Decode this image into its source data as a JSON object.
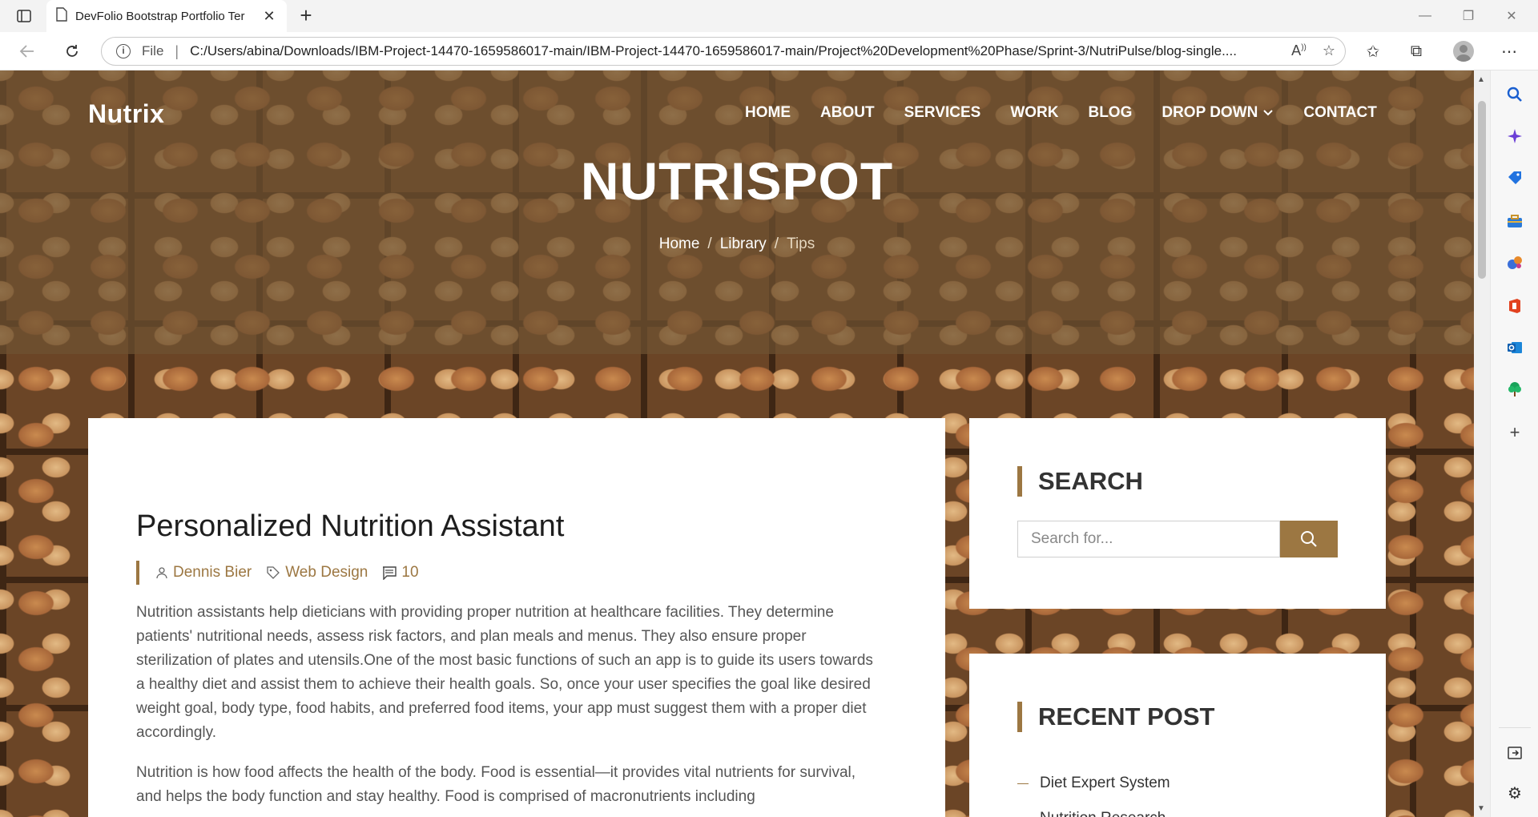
{
  "browser": {
    "tab_title": "DevFolio Bootstrap Portfolio Ter",
    "file_label": "File",
    "url": "C:/Users/abina/Downloads/IBM-Project-14470-1659586017-main/IBM-Project-14470-1659586017-main/Project%20Development%20Phase/Sprint-3/NutriPulse/blog-single...."
  },
  "site": {
    "brand": "Nutrix",
    "menu": [
      "HOME",
      "ABOUT",
      "SERVICES",
      "WORK",
      "BLOG",
      "DROP DOWN",
      "CONTACT"
    ],
    "hero_title": "NUTRISPOT",
    "breadcrumb": [
      "Home",
      "Library",
      "Tips"
    ]
  },
  "article": {
    "title": "Personalized Nutrition Assistant",
    "author": "Dennis Bier",
    "category": "Web Design",
    "comments": "10",
    "paragraphs": [
      "Nutrition assistants help dieticians with providing proper nutrition at healthcare facilities. They determine patients' nutritional needs, assess risk factors, and plan meals and menus. They also ensure proper sterilization of plates and utensils.One of the most basic functions of such an app is to guide its users towards a healthy diet and assist them to achieve their health goals. So, once your user specifies the goal like desired weight goal, body type, food habits, and preferred food items, your app must suggest them with a proper diet accordingly.",
      "Nutrition is how food affects the health of the body. Food is essential—it provides vital nutrients for survival, and helps the body function and stay healthy. Food is comprised of macronutrients including"
    ]
  },
  "sidebar": {
    "search_title": "SEARCH",
    "search_placeholder": "Search for...",
    "recent_title": "RECENT POST",
    "recent_posts": [
      "Diet Expert System",
      "Nutrition Research"
    ]
  },
  "colors": {
    "accent": "#9c7742",
    "hero_overlay": "#6e5232"
  }
}
